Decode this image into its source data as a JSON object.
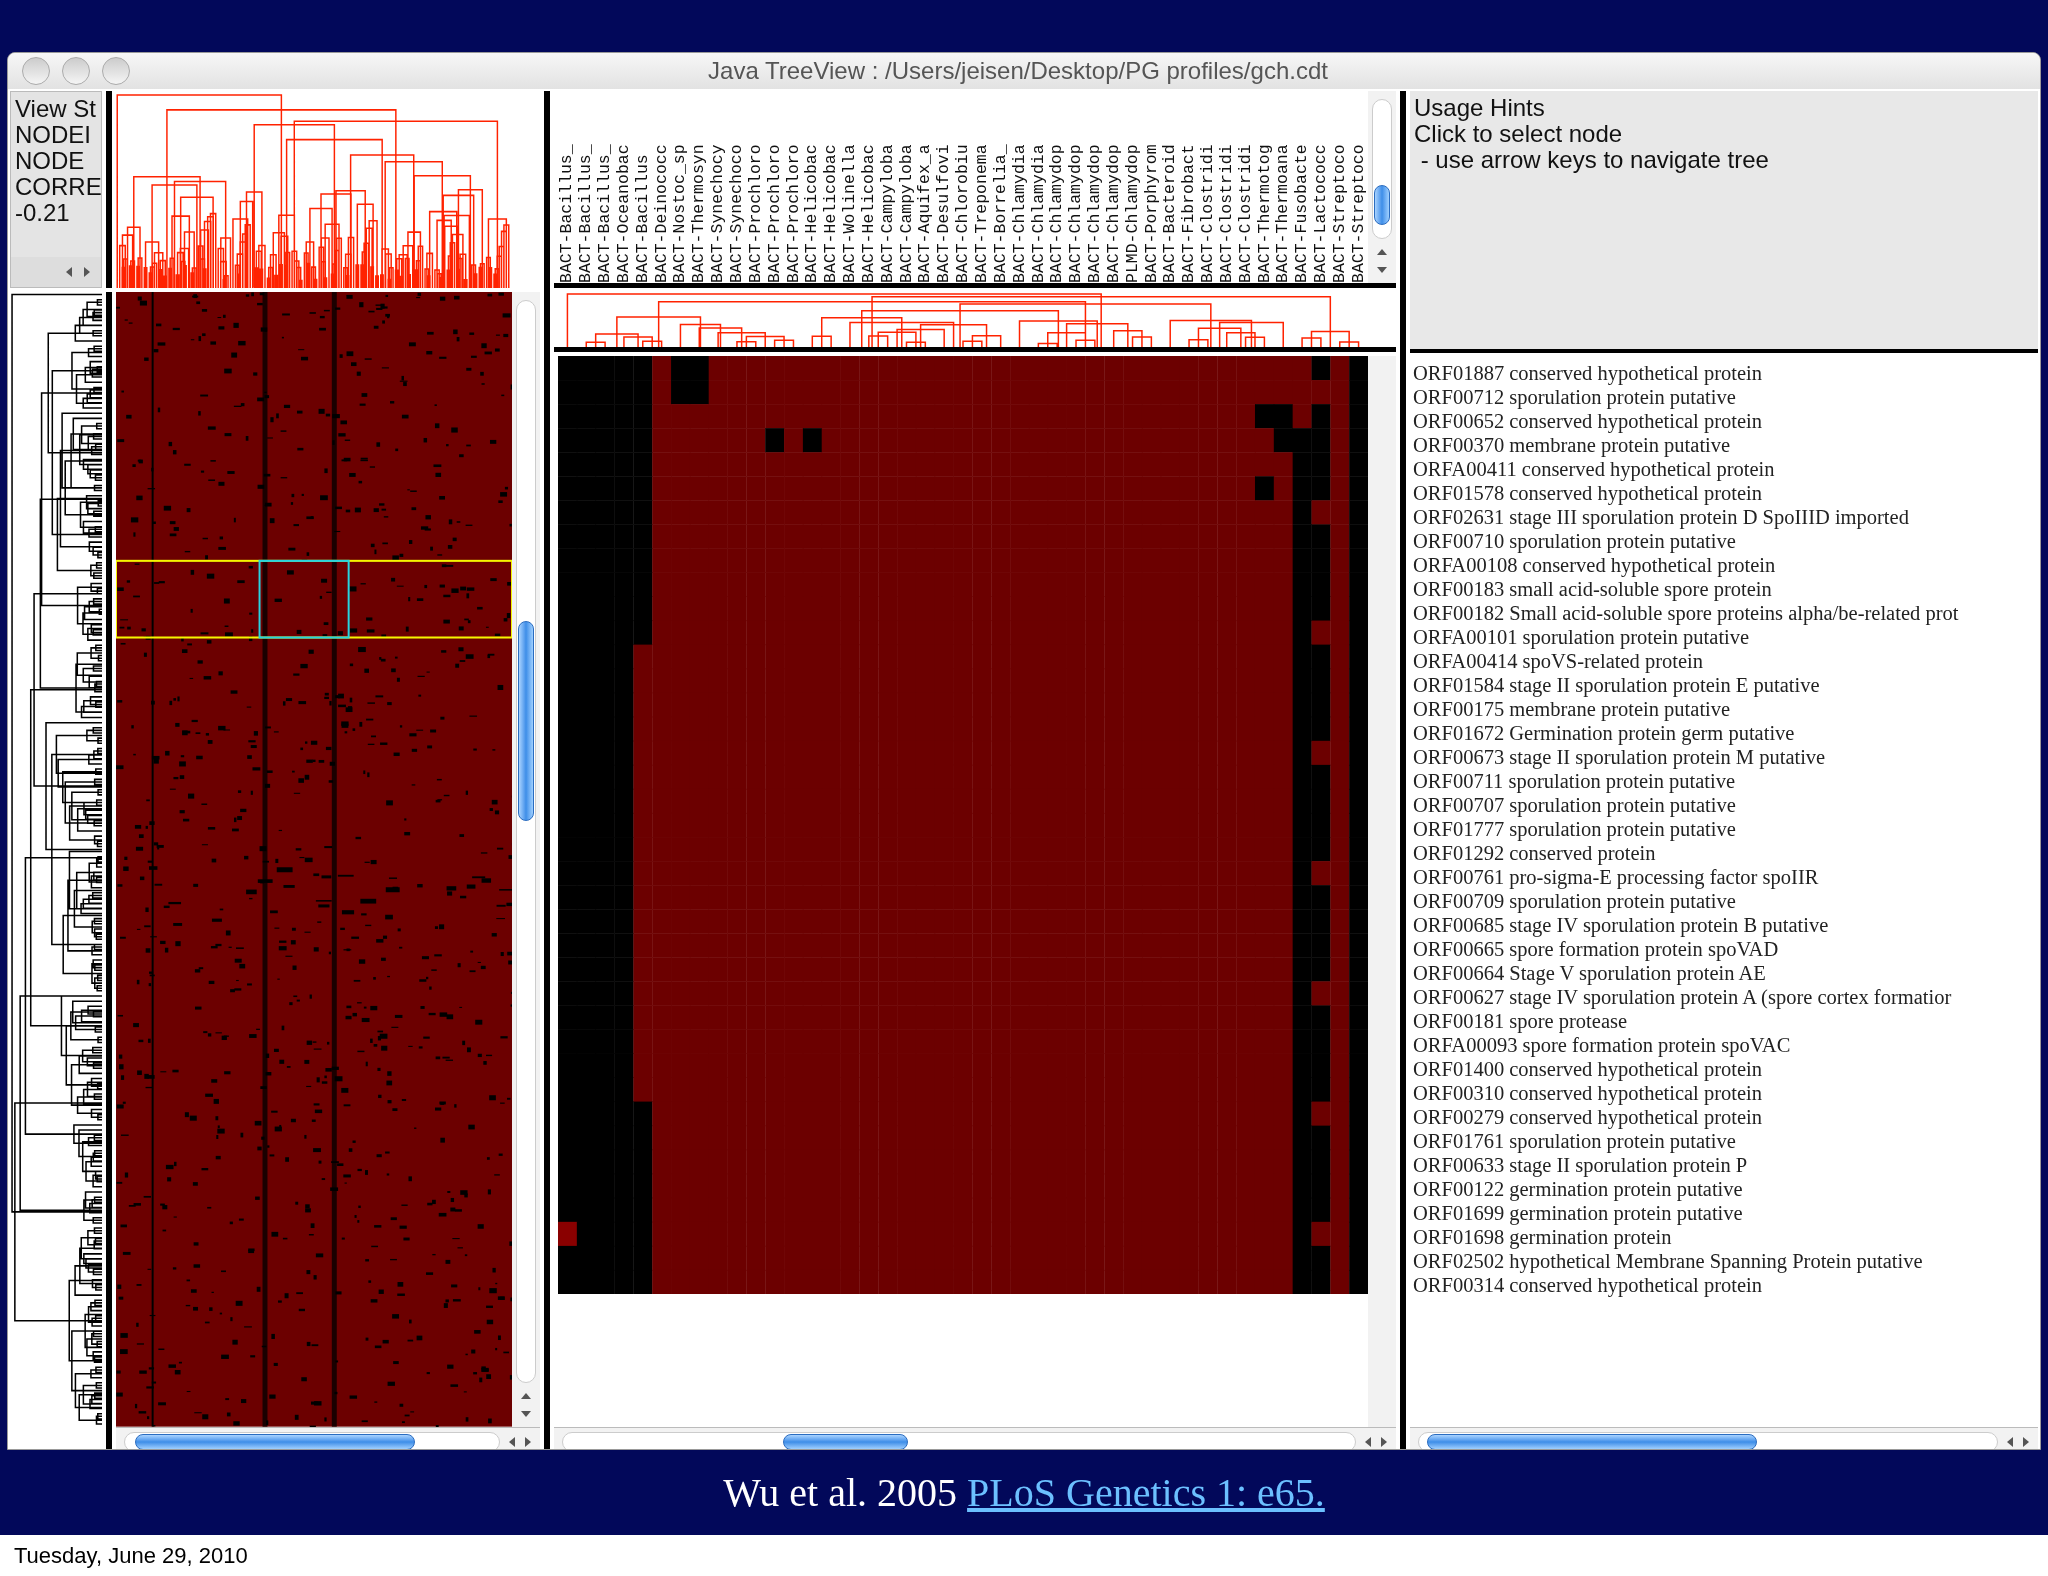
{
  "window": {
    "title": "Java TreeView : /Users/jeisen/Desktop/PG profiles/gch.cdt"
  },
  "info_panel": {
    "lines": [
      "View St",
      "NODEI",
      "NODE",
      "CORRE",
      "-0.21"
    ]
  },
  "column_labels": [
    "BACT-Bacillus_",
    "BACT-Bacillus_",
    "BACT-Bacillus_",
    "BACT-Oceanobac",
    "BACT-Bacillus",
    "BACT-Deinococc",
    "BACT-Nostoc_sp",
    "BACT-Thermosyn",
    "BACT-Synechocy",
    "BACT-Synechoco",
    "BACT-Prochloro",
    "BACT-Prochloro",
    "BACT-Prochloro",
    "BACT-Helicobac",
    "BACT-Helicobac",
    "BACT-Wolinella",
    "BACT-Helicobac",
    "BACT-Campyloba",
    "BACT-Campyloba",
    "BACT-Aquifex_a",
    "BACT-Desulfovi",
    "BACT-Chlorobiu",
    "BACT-Treponema",
    "BACT-Borrelia_",
    "BACT-Chlamydia",
    "BACT-Chlamydia",
    "BACT-Chlamydop",
    "BACT-Chlamydop",
    "BACT-Chlamydop",
    "BACT-Chlamydop",
    "PLMD-Chlamydop",
    "BACT-Porphyrom",
    "BACT-Bacteroid",
    "BACT-Fibrobact",
    "BACT-Clostridi",
    "BACT-Clostridi",
    "BACT-Clostridi",
    "BACT-Thermotog",
    "BACT-Thermoana",
    "BACT-Fusobacte",
    "BACT-Lactococc",
    "BACT-Streptoco",
    "BACT-Streptoco"
  ],
  "usage_hints": {
    "title": "Usage Hints",
    "lines": [
      "Click to select node",
      " - use arrow keys to navigate tree"
    ]
  },
  "genes": [
    "ORF01887 conserved hypothetical protein",
    "ORF00712 sporulation protein putative",
    "ORF00652 conserved hypothetical protein",
    "ORF00370 membrane protein putative",
    "ORFA00411 conserved hypothetical protein",
    "ORF01578 conserved hypothetical protein",
    "ORF02631 stage III sporulation protein D SpoIIID imported",
    "ORF00710 sporulation protein putative",
    "ORFA00108 conserved hypothetical protein",
    "ORF00183 small acid-soluble spore protein",
    "ORF00182 Small acid-soluble spore proteins alpha/be-related prot",
    "ORFA00101 sporulation protein putative",
    "ORFA00414 spoVS-related protein",
    "ORF01584 stage II sporulation protein E putative",
    "ORF00175 membrane protein putative",
    "ORF01672 Germination protein germ putative",
    "ORF00673 stage II sporulation protein M putative",
    "ORF00711 sporulation protein putative",
    "ORF00707 sporulation protein putative",
    "ORF01777 sporulation protein putative",
    "ORF01292 conserved protein",
    "ORF00761 pro-sigma-E processing factor spoIIR",
    "ORF00709 sporulation protein putative",
    "ORF00685 stage IV sporulation protein B putative",
    "ORF00665 spore formation protein spoVAD",
    "ORF00664 Stage V sporulation protein AE",
    "ORF00627 stage IV sporulation protein A (spore cortex formatior",
    "ORF00181 spore protease",
    "ORFA00093 spore formation protein spoVAC",
    "ORF01400 conserved hypothetical protein",
    "ORF00310 conserved hypothetical protein",
    "ORF00279 conserved hypothetical protein",
    "ORF01761 sporulation protein putative",
    "ORF00633 stage II sporulation protein P",
    "ORF00122 germination protein putative",
    "ORF01699 germination protein putative",
    "ORF01698 germination protein",
    "ORF02502 hypothetical Membrane Spanning Protein putative",
    "ORF00314 conserved hypothetical protein"
  ],
  "caption": {
    "text": "Wu et al. 2005",
    "link": "PLoS Genetics 1: e65."
  },
  "footer": {
    "date": "Tuesday, June 29, 2010"
  }
}
